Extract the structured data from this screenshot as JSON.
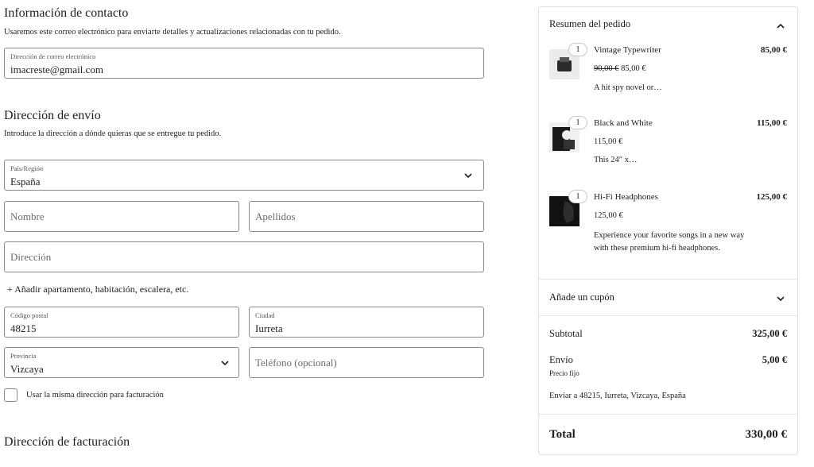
{
  "contact": {
    "title": "Información de contacto",
    "subtitle": "Usaremos este correo electrónico para enviarte detalles y actualizaciones relacionadas con tu pedido.",
    "email_label": "Dirección de correo electrónico",
    "email_value": "imacreste@gmail.com"
  },
  "shipping": {
    "title": "Dirección de envío",
    "subtitle": "Introduce la dirección a dónde quieras que se entregue tu pedido.",
    "country_label": "País/Región",
    "country_value": "España",
    "first_name_placeholder": "Nombre",
    "last_name_placeholder": "Apellidos",
    "address_placeholder": "Dirección",
    "add_apartment": "+ Añadir apartamento, habitación, escalera, etc.",
    "postcode_label": "Código postal",
    "postcode_value": "48215",
    "city_label": "Ciudad",
    "city_value": "Iurreta",
    "province_label": "Provincia",
    "province_value": "Vizcaya",
    "phone_placeholder": "Teléfono (opcional)",
    "same_billing_label": "Usar la misma dirección para facturación"
  },
  "billing": {
    "title": "Dirección de facturación"
  },
  "summary": {
    "title": "Resumen del pedido",
    "items": [
      {
        "qty": "1",
        "name": "Vintage Typewriter",
        "price": "85,00 €",
        "old_price": "90,00 €",
        "new_price": "85,00 €",
        "desc": "A hit spy novel or…"
      },
      {
        "qty": "1",
        "name": "Black and White",
        "price": "115,00 €",
        "unit_price": "115,00 €",
        "desc": "This 24″ x…"
      },
      {
        "qty": "1",
        "name": "Hi-Fi Headphones",
        "price": "125,00 €",
        "unit_price": "125,00 €",
        "desc": "Experience your favorite songs in a new way with these premium hi-fi headphones."
      }
    ],
    "coupon_label": "Añade un cupón",
    "subtotal_label": "Subtotal",
    "subtotal_value": "325,00 €",
    "shipping_label": "Envío",
    "shipping_value": "5,00 €",
    "shipping_note": "Precio fijo",
    "ship_to": "Enviar a 48215, Iurreta, Vizcaya, España",
    "total_label": "Total",
    "total_value": "330,00 €"
  },
  "colors": {
    "text": "#1e1e1e",
    "border": "#8a8a8a",
    "muted": "#6b6b6b"
  }
}
